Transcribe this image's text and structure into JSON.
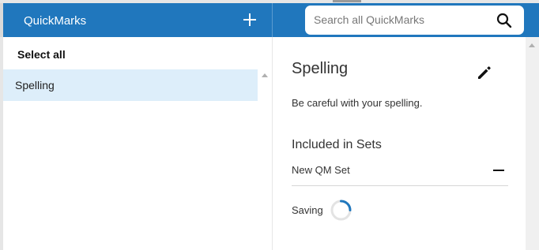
{
  "header": {
    "title": "QuickMarks",
    "add_icon": "plus-icon",
    "search": {
      "placeholder": "Search all QuickMarks",
      "value": "",
      "icon": "search-icon"
    },
    "background_color": "#2077bd"
  },
  "left_panel": {
    "select_all_label": "Select all",
    "items": [
      {
        "label": "Spelling",
        "selected": true
      }
    ],
    "selected_color": "#ddeefa"
  },
  "detail": {
    "title": "Spelling",
    "edit_icon": "pencil-icon",
    "description": "Be careful with your spelling.",
    "sets_heading": "Included in Sets",
    "sets": [
      {
        "name": "New QM Set",
        "remove_icon": "minus-icon"
      }
    ],
    "status_label": "Saving",
    "status_icon": "spinner-icon",
    "spinner_color": "#2077bd"
  }
}
